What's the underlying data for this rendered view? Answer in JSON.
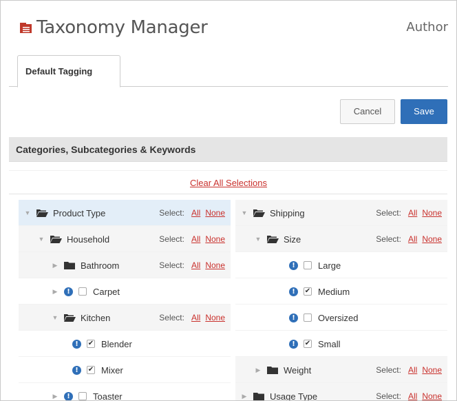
{
  "app": {
    "title": "Taxonomy Manager",
    "user": "Author",
    "icon": "folder-stack-icon"
  },
  "tabs": [
    {
      "label": "Default Tagging"
    }
  ],
  "actions": {
    "cancel_label": "Cancel",
    "save_label": "Save"
  },
  "section": {
    "title": "Categories, Subcategories & Keywords",
    "clear_label": "Clear All Selections"
  },
  "select": {
    "label": "Select:",
    "all": "All",
    "none": "None"
  },
  "left_tree": [
    {
      "label": "Product Type",
      "kind": "folder-open",
      "level": 0,
      "selectors": true,
      "style": "selected"
    },
    {
      "label": "Household",
      "kind": "folder-open",
      "level": 1,
      "selectors": true,
      "style": "alt"
    },
    {
      "label": "Bathroom",
      "kind": "folder-closed",
      "level": 2,
      "selectors": true,
      "style": "alt"
    },
    {
      "label": "Carpet",
      "kind": "checkbox",
      "level": 2,
      "checked": false,
      "expandable": true,
      "style": ""
    },
    {
      "label": "Kitchen",
      "kind": "folder-open",
      "level": 2,
      "selectors": true,
      "style": "alt"
    },
    {
      "label": "Blender",
      "kind": "checkbox",
      "level": 3,
      "checked": true,
      "style": ""
    },
    {
      "label": "Mixer",
      "kind": "checkbox",
      "level": 3,
      "checked": true,
      "style": ""
    },
    {
      "label": "Toaster",
      "kind": "checkbox",
      "level": 2,
      "checked": false,
      "expandable": true,
      "style": ""
    }
  ],
  "right_tree": [
    {
      "label": "Shipping",
      "kind": "folder-open",
      "level": 0,
      "selectors": true,
      "style": "alt"
    },
    {
      "label": "Size",
      "kind": "folder-open",
      "level": 1,
      "selectors": true,
      "style": "alt"
    },
    {
      "label": "Large",
      "kind": "checkbox",
      "level": 3,
      "checked": false,
      "style": ""
    },
    {
      "label": "Medium",
      "kind": "checkbox",
      "level": 3,
      "checked": true,
      "style": ""
    },
    {
      "label": "Oversized",
      "kind": "checkbox",
      "level": 3,
      "checked": false,
      "style": ""
    },
    {
      "label": "Small",
      "kind": "checkbox",
      "level": 3,
      "checked": true,
      "style": ""
    },
    {
      "label": "Weight",
      "kind": "folder-closed",
      "level": 1,
      "selectors": true,
      "style": "alt"
    },
    {
      "label": "Usage Type",
      "kind": "folder-closed",
      "level": 0,
      "selectors": true,
      "style": "alt"
    }
  ],
  "colors": {
    "accent": "#2f6fb8",
    "link": "#c9302c",
    "icon_red": "#c0392b"
  }
}
